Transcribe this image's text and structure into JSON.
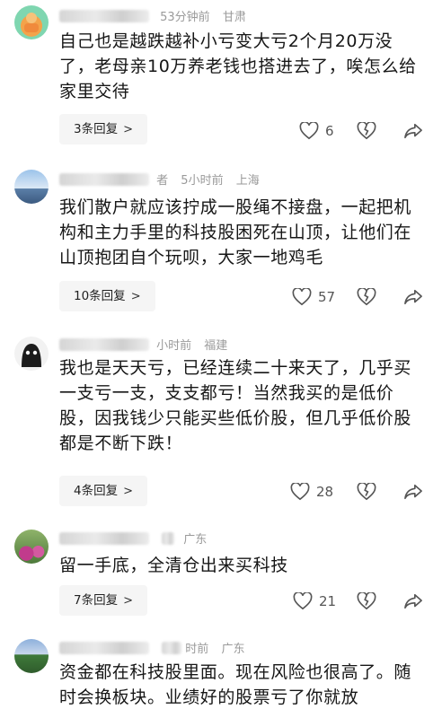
{
  "comments": [
    {
      "time": "53分钟前",
      "location": "甘肃",
      "text": "自己也是越跌越补小亏变大亏2个月20万没了，老母亲10万养老钱也搭进去了，唉怎么给家里交待",
      "replies": "3条回复",
      "likes": "6",
      "avatar_colors": [
        "#7fd6b0",
        "#f3a34a"
      ]
    },
    {
      "time_prefix": "者",
      "time": "5小时前",
      "location": "上海",
      "text": "我们散户就应该拧成一股绳不接盘，一起把机构和主力手里的科技股困死在山顶，让他们在山顶抱团自个玩呗，大家一地鸡毛",
      "replies": "10条回复",
      "likes": "57",
      "avatar_colors": [
        "#7aa6d8",
        "#e8eef5"
      ]
    },
    {
      "time": "小时前",
      "location": "福建",
      "text": "我也是天天亏，已经连续二十来天了，几乎买一支亏一支，支支都亏！当然我买的是低价股，因我钱少只能买些低价股，但几乎低价股都是不断下跌！",
      "replies": "4条回复",
      "likes": "28",
      "avatar_colors": [
        "#1c1c1c",
        "#ffffff"
      ]
    },
    {
      "time": "",
      "location": "广东",
      "text": "留一手底，全清仓出来买科技",
      "replies": "7条回复",
      "likes": "21",
      "avatar_colors": [
        "#4d7a3b",
        "#c13b8c"
      ]
    },
    {
      "time": "时前",
      "location": "广东",
      "text": "资金都在科技股里面。现在风险也很高了。随时会换板块。业绩好的股票亏了你就放",
      "avatar_colors": [
        "#5c7fb8",
        "#3f7a3a"
      ]
    }
  ],
  "reply_chevron": ">",
  "icons": [
    "heart-icon",
    "broken-heart-icon",
    "share-icon"
  ]
}
